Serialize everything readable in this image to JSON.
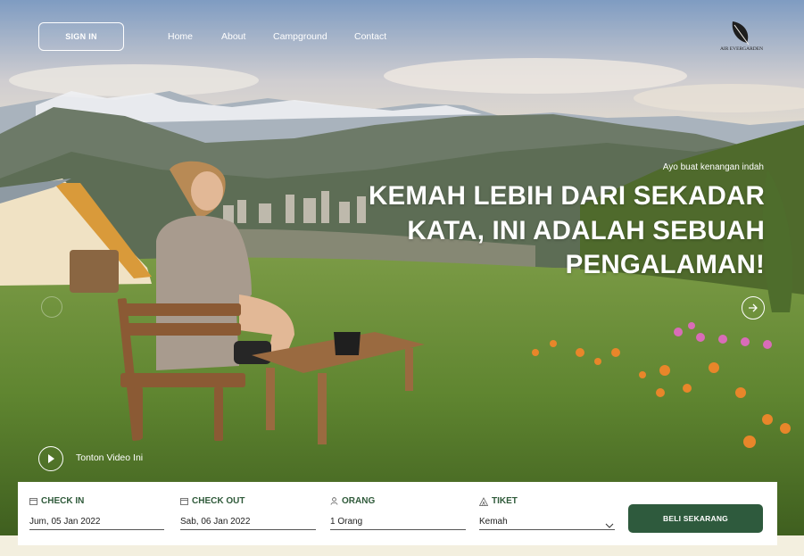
{
  "nav": {
    "signin_label": "SIGN IN",
    "links": [
      "Home",
      "About",
      "Campground",
      "Contact"
    ],
    "logo_text": "AIR EVERGARDEN"
  },
  "hero": {
    "tagline": "Ayo buat kenangan indah",
    "headline_lines": [
      "KEMAH LEBIH DARI SEKADAR",
      "KATA, INI ADALAH SEBUAH",
      "PENGALAMAN!"
    ],
    "video_label": "Tonton Video Ini"
  },
  "booking": {
    "checkin": {
      "label": "CHECK IN",
      "value": "Jum, 05 Jan 2022",
      "icon": "calendar-icon"
    },
    "checkout": {
      "label": "CHECK OUT",
      "value": "Sab, 06 Jan 2022",
      "icon": "calendar-icon"
    },
    "guests": {
      "label": "ORANG",
      "value": "1 Orang",
      "icon": "person-icon"
    },
    "ticket": {
      "label": "TIKET",
      "value": "Kemah",
      "icon": "tent-icon"
    },
    "buy_label": "BELI SEKARANG"
  },
  "colors": {
    "accent": "#2e5a3d",
    "label": "#2f5a3a",
    "footer_bg": "#f3efdf"
  }
}
